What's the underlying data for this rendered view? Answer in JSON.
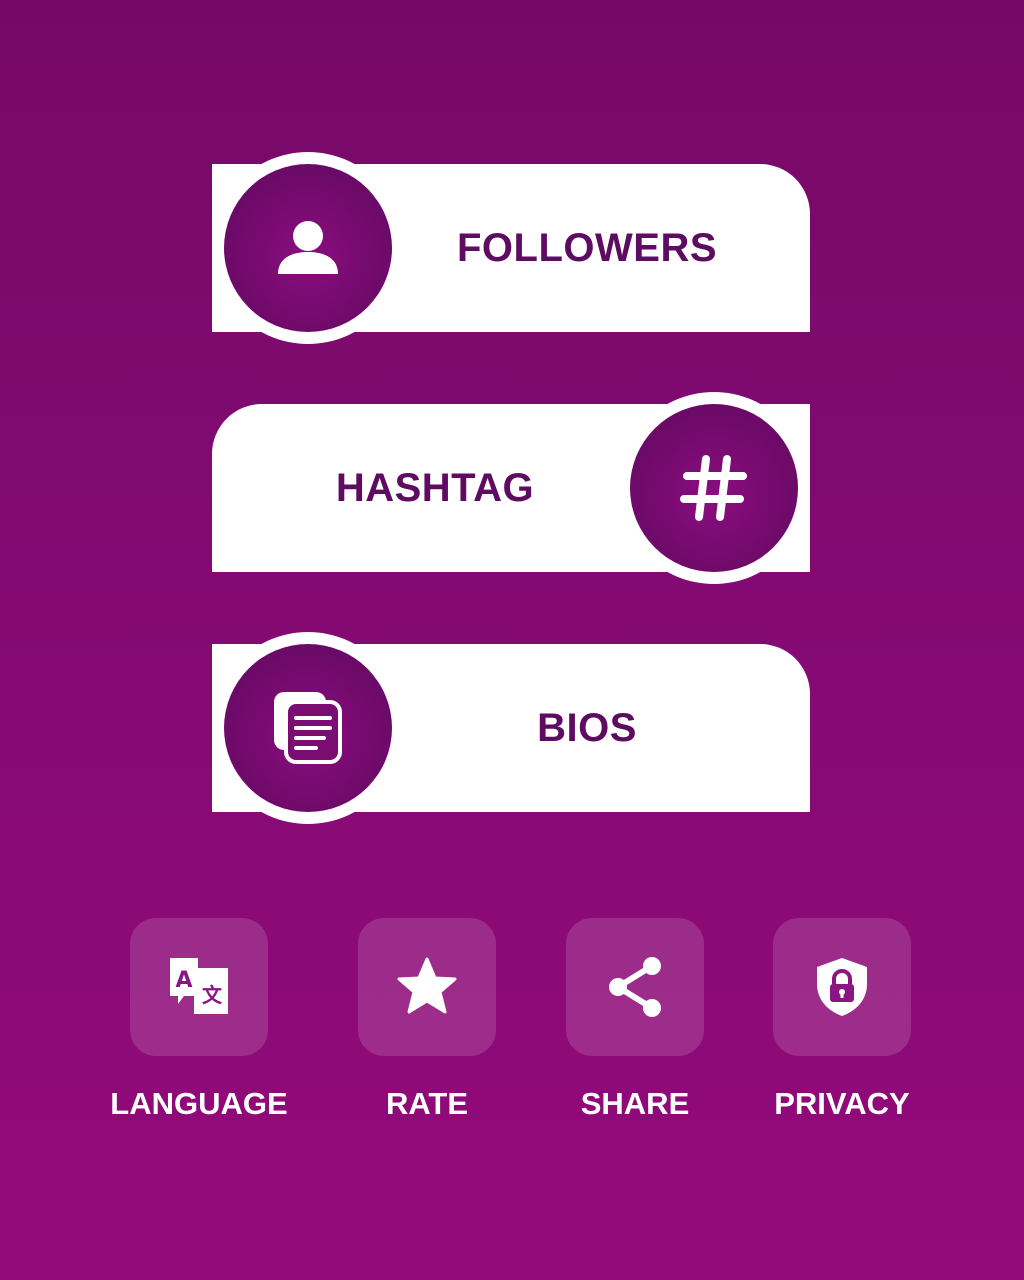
{
  "menu": [
    {
      "label": "FOLLOWERS",
      "icon": "person-icon"
    },
    {
      "label": "HASHTAG",
      "icon": "hashtag-icon"
    },
    {
      "label": "BIOS",
      "icon": "document-icon"
    }
  ],
  "actions": [
    {
      "label": "LANGUAGE",
      "icon": "translate-icon"
    },
    {
      "label": "RATE",
      "icon": "star-icon"
    },
    {
      "label": "SHARE",
      "icon": "share-icon"
    },
    {
      "label": "PRIVACY",
      "icon": "lock-shield-icon"
    }
  ],
  "colors": {
    "background_top": "#760968",
    "background_bottom": "#930a7a",
    "label_purple": "#5e0c61",
    "card_white": "#ffffff"
  }
}
